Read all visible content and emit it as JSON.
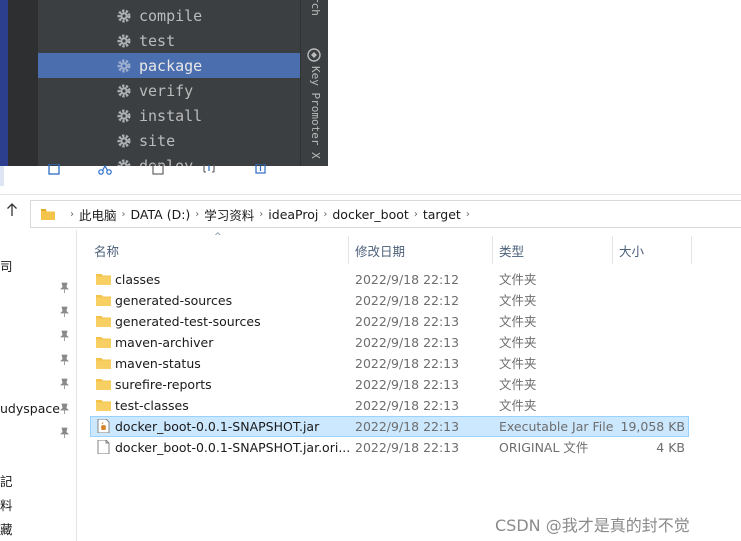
{
  "ide": {
    "lifecycle": [
      {
        "label": "compile",
        "selected": false
      },
      {
        "label": "test",
        "selected": false
      },
      {
        "label": "package",
        "selected": true
      },
      {
        "label": "verify",
        "selected": false
      },
      {
        "label": "install",
        "selected": false
      },
      {
        "label": "site",
        "selected": false
      },
      {
        "label": "deploy",
        "selected": false
      }
    ],
    "side_tab_search": "rch",
    "side_tab_key_promoter": "Key Promoter X"
  },
  "explorer": {
    "breadcrumb": [
      "此电脑",
      "DATA (D:)",
      "学习资料",
      "ideaProj",
      "docker_boot",
      "target"
    ],
    "nav_items": {
      "item1": "司",
      "item2": "udyspace",
      "item3": "記",
      "item4": "料",
      "item5": "藏"
    },
    "columns": {
      "name": "名称",
      "modified": "修改日期",
      "type": "类型",
      "size": "大小"
    },
    "files": [
      {
        "name": "classes",
        "date": "2022/9/18 22:12",
        "type": "文件夹",
        "size": "",
        "icon": "folder-icon",
        "selected": false
      },
      {
        "name": "generated-sources",
        "date": "2022/9/18 22:12",
        "type": "文件夹",
        "size": "",
        "icon": "folder-icon",
        "selected": false
      },
      {
        "name": "generated-test-sources",
        "date": "2022/9/18 22:13",
        "type": "文件夹",
        "size": "",
        "icon": "folder-icon",
        "selected": false
      },
      {
        "name": "maven-archiver",
        "date": "2022/9/18 22:13",
        "type": "文件夹",
        "size": "",
        "icon": "folder-icon",
        "selected": false
      },
      {
        "name": "maven-status",
        "date": "2022/9/18 22:13",
        "type": "文件夹",
        "size": "",
        "icon": "folder-icon",
        "selected": false
      },
      {
        "name": "surefire-reports",
        "date": "2022/9/18 22:13",
        "type": "文件夹",
        "size": "",
        "icon": "folder-icon",
        "selected": false
      },
      {
        "name": "test-classes",
        "date": "2022/9/18 22:13",
        "type": "文件夹",
        "size": "",
        "icon": "folder-icon",
        "selected": false
      },
      {
        "name": "docker_boot-0.0.1-SNAPSHOT.jar",
        "date": "2022/9/18 22:13",
        "type": "Executable Jar File",
        "size": "19,058 KB",
        "icon": "jar-file-icon",
        "selected": true
      },
      {
        "name": "docker_boot-0.0.1-SNAPSHOT.jar.ori...",
        "date": "2022/9/18 22:13",
        "type": "ORIGINAL 文件",
        "size": "4 KB",
        "icon": "file-icon",
        "selected": false
      }
    ]
  },
  "watermark": "CSDN @我才是真的封不觉",
  "colors": {
    "ide_bg": "#3c3f41",
    "ide_selection": "#4b6eaf",
    "explorer_selection": "#cce8ff",
    "folder": "#f4c34c"
  }
}
